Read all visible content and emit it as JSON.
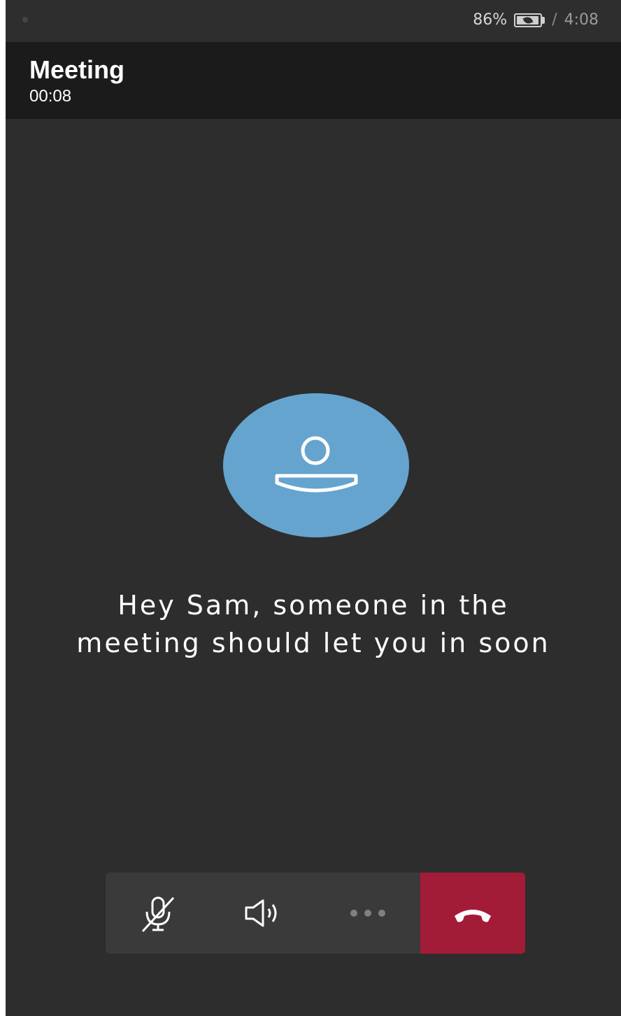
{
  "status_bar": {
    "battery_percent": "86%",
    "time": "4:08",
    "separator": "/"
  },
  "header": {
    "title": "Meeting",
    "timer": "00:08"
  },
  "lobby": {
    "message": "Hey Sam, someone in the meeting should let you in soon"
  },
  "controls": [
    {
      "name": "mute-microphone",
      "icon": "microphone-off-icon",
      "state": "muted"
    },
    {
      "name": "speaker",
      "icon": "speaker-icon"
    },
    {
      "name": "more-options",
      "icon": "more-horizontal-icon"
    },
    {
      "name": "hang-up",
      "icon": "phone-hangup-icon"
    }
  ],
  "colors": {
    "background": "#2d2d2d",
    "header": "#1b1b1b",
    "avatar": "#65a4ce",
    "hangup": "#a31c37"
  }
}
